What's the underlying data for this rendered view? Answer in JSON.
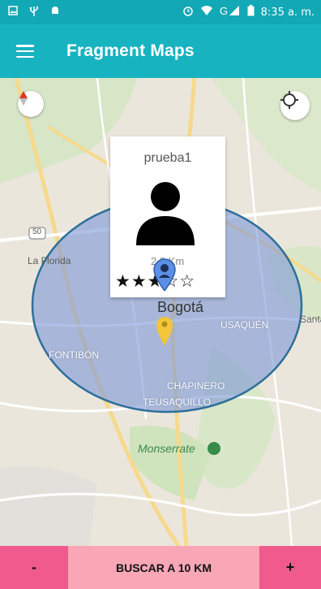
{
  "status_bar": {
    "time": "8:35 a. m.",
    "left_icons": [
      "image-icon",
      "usb-icon",
      "android-icon"
    ],
    "right_icons": [
      "alarm-icon",
      "wifi-icon",
      "signal-icon",
      "battery-icon"
    ]
  },
  "app_bar": {
    "title": "Fragment Maps",
    "menu_icon": "menu-icon"
  },
  "map": {
    "labels": {
      "la_florida": "La Florida",
      "bogota": "Bogotá",
      "usaquen": "USAQUÉN",
      "santa": "Santa",
      "fontibon": "FONTIBÓN",
      "chapinero": "CHAPINERO",
      "teusaquillo": "TEUSAQUILLO",
      "monserrate": "Monserrate",
      "route": "50"
    },
    "compass_icon": "compass-icon",
    "locate_icon": "my-location-icon"
  },
  "info_window": {
    "name": "prueba1",
    "distance": "2.3 Km",
    "rating": 3,
    "max_rating": 5,
    "stars": "★★★☆☆",
    "avatar_icon": "person-icon"
  },
  "bottom_bar": {
    "minus_label": "-",
    "search_label": "BUSCAR A 10 KM",
    "plus_label": "+"
  },
  "colors": {
    "status_bar": "#12a8b5",
    "app_bar": "#18b3c0",
    "radius_fill": "#7f99d6",
    "radius_stroke": "#2d6f9a",
    "minus_plus": "#f05a8c",
    "search": "#f9a6b7"
  }
}
